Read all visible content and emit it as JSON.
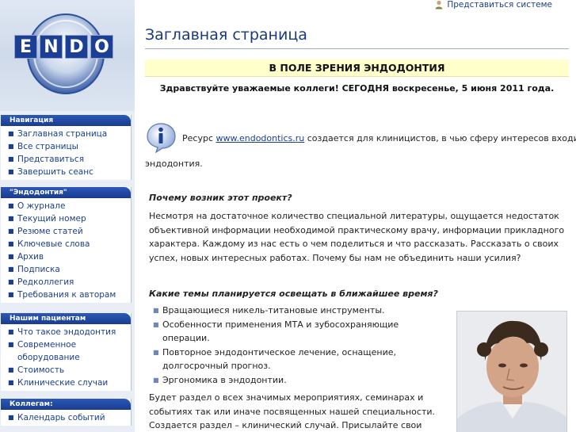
{
  "topbar": {
    "login_label": "Представиться системе",
    "login_icon": "user-icon"
  },
  "logo": {
    "letters": [
      "E",
      "N",
      "D",
      "O"
    ]
  },
  "sidebar": {
    "sections": [
      {
        "title": "Навигация",
        "items": [
          "Заглавная страница",
          "Все страницы",
          "Представиться",
          "Завершить сеанс"
        ]
      },
      {
        "title": "\"Эндодонтия\"",
        "items": [
          "О журнале",
          "Текущий номер",
          "Резюме статей",
          "Ключевые слова",
          "Архив",
          "Подписка",
          "Редколлегия",
          "Требования к авторам"
        ]
      },
      {
        "title": "Нашим пациентам",
        "items": [
          "Что такое эндодонтия",
          "Современное оборудование",
          "Стоимость",
          "Клинические случаи"
        ]
      },
      {
        "title": "Коллегам:",
        "items": [
          "Календарь событий"
        ]
      }
    ]
  },
  "main": {
    "title": "Заглавная страница",
    "banner": "В ПОЛЕ ЗРЕНИЯ ЭНДОДОНТИЯ",
    "greeting": "Здравствуйте уважаемые коллеги! СЕГОДНЯ воскресенье, 5 июня 2011 года.",
    "intro_prefix": "Ресурс ",
    "intro_link": "www.endodontics.ru",
    "intro_suffix": " создается для клиницистов, в чью сферу интересов входит",
    "intro_line2": "эндодонтия.",
    "q1": "Почему возник этот проект?",
    "p1": "Несмотря на достаточное количество специальной литературы, ощущается недостаток объективной информации необходимой практическому врачу, информации прикладного характера. Каждому из нас есть о чем поделиться и что рассказать. Рассказать о своих успех, новых интересных работах. Почему бы нам не объединить наши усилия?",
    "q2": "Какие темы планируется освещать в ближайшее время?",
    "topics": [
      "Вращающиеся никель-титановые инструменты.",
      "Особенности применения МТА и зубосохраняющие операции.",
      "Повторное эндодонтическое лечение, оснащение, долгосрочный прогноз.",
      "Эргономика в эндодонтии."
    ],
    "p2": "Будет раздел о всех значимых мероприятиях, семинарах и событиях так или иначе посвященных нашей специальности. Создается раздел – клинический случай. Присылайте свои работы,"
  },
  "colors": {
    "nav_header": "#1a3c8e",
    "link": "#1a3f8f",
    "banner_bg": "#ffffcc",
    "title": "#1a3a78"
  }
}
